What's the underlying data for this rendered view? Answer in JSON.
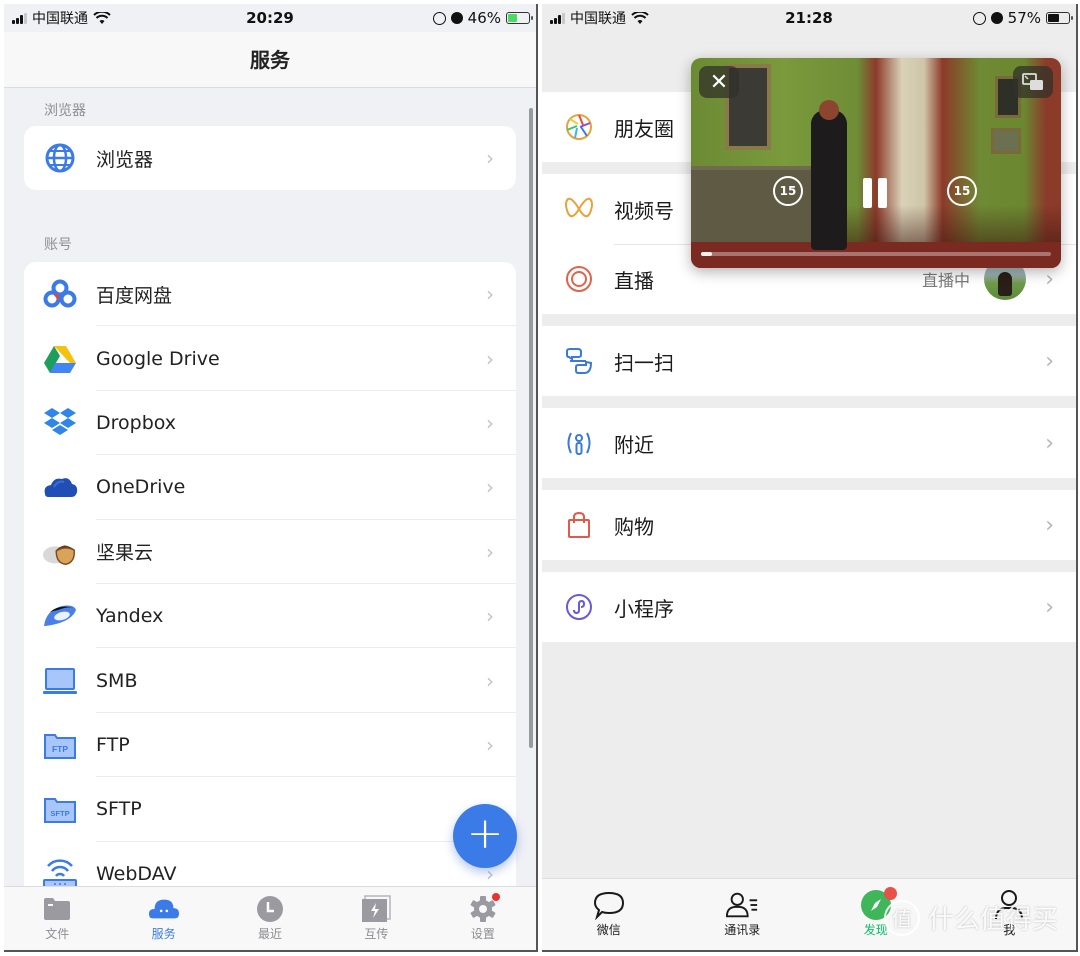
{
  "left": {
    "status": {
      "carrier": "中国联通",
      "time": "20:29",
      "battery": "46%",
      "battery_level": 0.46,
      "battery_color": "#4cd964",
      "charging": true
    },
    "nav_title": "服务",
    "sections": [
      {
        "label": "浏览器",
        "items": [
          {
            "label": "浏览器",
            "icon": "globe-icon"
          }
        ]
      },
      {
        "label": "账号",
        "items": [
          {
            "label": "百度网盘",
            "icon": "baidu-netdisk-icon"
          },
          {
            "label": "Google Drive",
            "icon": "google-drive-icon"
          },
          {
            "label": "Dropbox",
            "icon": "dropbox-icon"
          },
          {
            "label": "OneDrive",
            "icon": "onedrive-icon"
          },
          {
            "label": "坚果云",
            "icon": "jianguoyun-icon"
          },
          {
            "label": "Yandex",
            "icon": "yandex-icon"
          },
          {
            "label": "SMB",
            "icon": "smb-laptop-icon"
          },
          {
            "label": "FTP",
            "icon": "ftp-folder-icon"
          },
          {
            "label": "SFTP",
            "icon": "sftp-folder-icon"
          },
          {
            "label": "WebDAV",
            "icon": "webdav-icon"
          }
        ]
      }
    ],
    "ftp_badge": "FTP",
    "sftp_badge": "SFTP",
    "fab_label": "+",
    "chevron": "›",
    "tabs": [
      {
        "label": "文件",
        "icon": "folder-icon"
      },
      {
        "label": "服务",
        "icon": "cloud-icon",
        "active": true
      },
      {
        "label": "最近",
        "icon": "clock-icon"
      },
      {
        "label": "互传",
        "icon": "transfer-icon"
      },
      {
        "label": "设置",
        "icon": "gear-icon",
        "badge": true
      }
    ],
    "accent_color": "#3b7be8"
  },
  "right": {
    "status": {
      "carrier": "中国联通",
      "time": "21:28",
      "battery": "57%",
      "battery_level": 0.57,
      "battery_color": "#111111",
      "charging": false
    },
    "menu": [
      {
        "label": "朋友圈",
        "icon": "moments-icon"
      },
      {
        "label": "视频号",
        "icon": "channels-icon"
      },
      {
        "label": "直播",
        "icon": "live-icon",
        "status": "直播中"
      },
      {
        "label": "扫一扫",
        "icon": "scan-icon"
      },
      {
        "label": "附近",
        "icon": "nearby-icon"
      },
      {
        "label": "购物",
        "icon": "shopping-bag-icon"
      },
      {
        "label": "小程序",
        "icon": "mini-program-icon"
      }
    ],
    "chevron": "›",
    "video": {
      "close": "✕",
      "skip_back": "15",
      "skip_forward": "15",
      "progress": 0.03
    },
    "tabs": [
      {
        "label": "微信",
        "icon": "chat-bubble-icon"
      },
      {
        "label": "通讯录",
        "icon": "contacts-icon"
      },
      {
        "label": "发现",
        "icon": "discover-compass-icon",
        "active": true,
        "badge": true
      },
      {
        "label": "我",
        "icon": "me-icon"
      }
    ],
    "accent_color": "#07c160"
  },
  "watermark": {
    "badge": "值",
    "text": "什么值得买"
  }
}
